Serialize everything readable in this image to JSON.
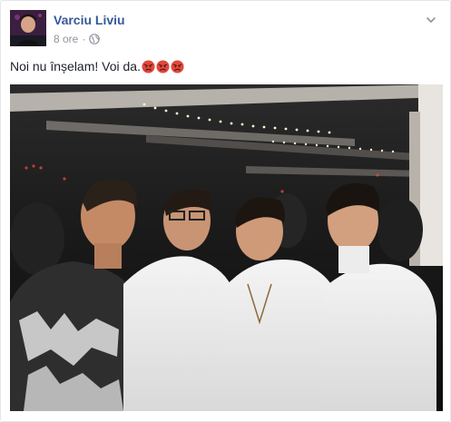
{
  "post": {
    "author": "Varciu Liviu",
    "time": "8 ore",
    "separator": "·",
    "text": "Noi nu înșelam! Voi da.",
    "emojis": [
      "angry-face-icon",
      "angry-face-icon",
      "angry-face-icon"
    ],
    "photo_description_icon": "group-photo"
  },
  "colors": {
    "author_link": "#365899",
    "meta_gray": "#90949c",
    "body_text": "#1d2129",
    "emoji_red": "#e0483b"
  }
}
